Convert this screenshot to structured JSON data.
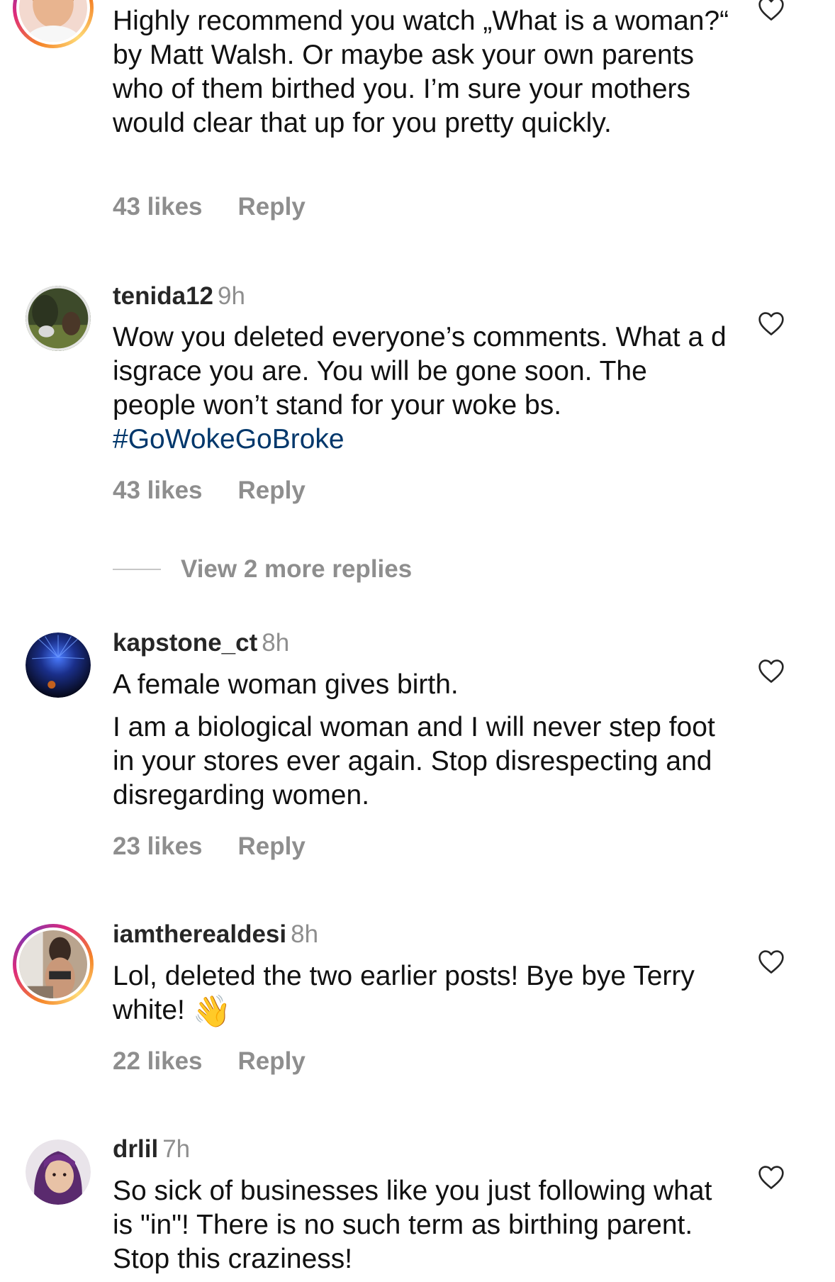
{
  "comments": [
    {
      "username": "",
      "time": "",
      "text": "Highly recommend you watch „What is a woman?“ by Matt Walsh. Or maybe ask your own parents who of them birthed you. I’m sure your mothers would clear that up for you pretty quickly.",
      "likes": "43 likes",
      "reply": "Reply",
      "has_story_ring": true
    },
    {
      "username": "tenida12",
      "time": "9h",
      "text": "Wow you deleted everyone’s comments. What a d isgrace you are. You will be gone soon. The people won’t stand for your woke bs.",
      "hashtag": "#GoWokeGoBroke",
      "likes": "43 likes",
      "reply": "Reply",
      "view_more_replies": "View 2 more replies"
    },
    {
      "username": "kapstone_ct",
      "time": "8h",
      "text": "A female woman gives birth.",
      "text2": "I am a biological woman  and I will never step foot in your stores ever again. Stop disrespecting and disregarding women.",
      "likes": "23 likes",
      "reply": "Reply"
    },
    {
      "username": "iamtherealdesi",
      "time": "8h",
      "text": "Lol, deleted the two earlier posts! Bye bye Terry white!",
      "emoji": "👋",
      "likes": "22 likes",
      "reply": "Reply",
      "has_story_ring": true
    },
    {
      "username": "drlil",
      "time": "7h",
      "text": "So sick of businesses like you just following what is \"in\"! There is no such term as birthing parent. Stop this craziness!"
    }
  ],
  "colors": {
    "secondary_text": "#8e8e8e",
    "hashtag": "#00376b",
    "primary_text": "#111111"
  },
  "icons": {
    "like": "heart-outline-icon"
  }
}
